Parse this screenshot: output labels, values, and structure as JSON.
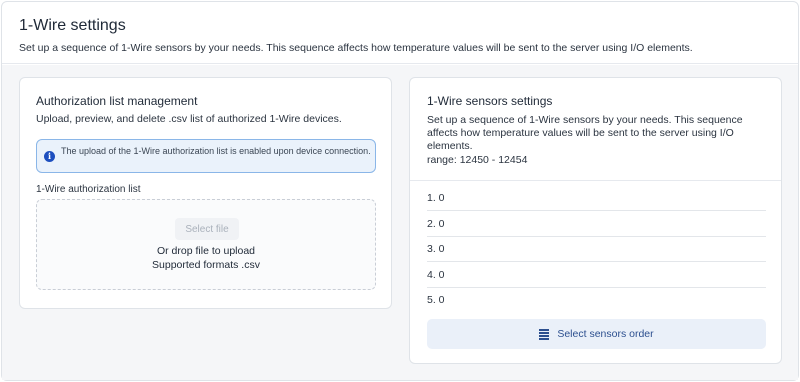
{
  "header": {
    "title": "1-Wire settings",
    "subtitle": "Set up a sequence of 1-Wire sensors by your needs. This sequence affects how temperature values will be sent to the server using I/O elements."
  },
  "auth_card": {
    "title": "Authorization list management",
    "description": "Upload, preview, and delete .csv list of authorized 1-Wire devices.",
    "info_icon": "info-icon",
    "info_text": "The upload of the 1-Wire authorization list is enabled upon device connection.",
    "field_label": "1-Wire authorization list",
    "select_file_label": "Select file",
    "drop_text": "Or drop file to upload",
    "formats_text": "Supported formats .csv"
  },
  "sensors_card": {
    "title": "1-Wire sensors settings",
    "description": "Set up a sequence of 1-Wire sensors by your needs. This sequence affects how temperature values will be sent to the server using I/O elements.",
    "range_text": "range: 12450 - 12454",
    "sensors": [
      {
        "label": "1. 0"
      },
      {
        "label": "2. 0"
      },
      {
        "label": "3. 0"
      },
      {
        "label": "4. 0"
      },
      {
        "label": "5. 0"
      }
    ],
    "order_button_icon": "list-icon",
    "order_button_label": "Select sensors order"
  },
  "colors": {
    "info_border": "#8ab6e8",
    "info_background": "#eaf2fb",
    "info_icon": "#1d4fbf",
    "button_background": "#eaf0f9",
    "button_text": "#2c4f8f"
  }
}
